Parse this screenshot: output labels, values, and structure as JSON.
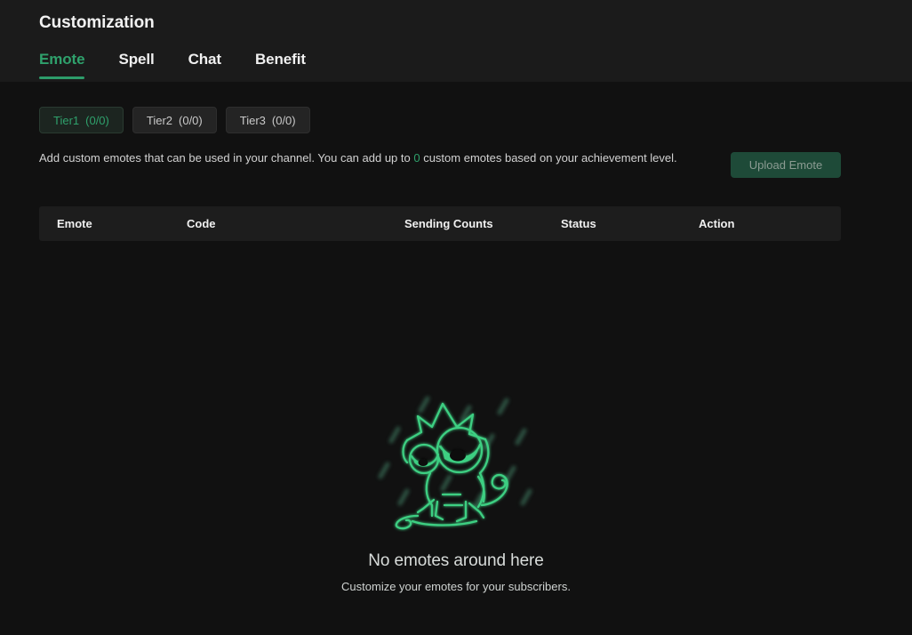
{
  "header": {
    "title": "Customization",
    "tabs": [
      {
        "label": "Emote",
        "active": true
      },
      {
        "label": "Spell",
        "active": false
      },
      {
        "label": "Chat",
        "active": false
      },
      {
        "label": "Benefit",
        "active": false
      }
    ]
  },
  "tiers": [
    {
      "label": "Tier1",
      "count": "(0/0)",
      "active": true
    },
    {
      "label": "Tier2",
      "count": "(0/0)",
      "active": false
    },
    {
      "label": "Tier3",
      "count": "(0/0)",
      "active": false
    }
  ],
  "description": {
    "part1": "Add custom emotes that can be used in your channel. You can add up to ",
    "highlight": "0",
    "part2": " custom emotes based on your achievement level."
  },
  "upload": {
    "label": "Upload Emote"
  },
  "table": {
    "columns": [
      {
        "key": "emote",
        "label": "Emote"
      },
      {
        "key": "code",
        "label": "Code"
      },
      {
        "key": "count",
        "label": "Sending Counts"
      },
      {
        "key": "status",
        "label": "Status"
      },
      {
        "key": "action",
        "label": "Action"
      }
    ],
    "rows": []
  },
  "empty_state": {
    "illustration": "chameleon-rain-illustration",
    "title": "No emotes around here",
    "subtitle": "Customize your emotes for your subscribers."
  },
  "colors": {
    "accent_green": "#2fa16c",
    "page_background": "#111111",
    "header_background": "#1b1b1b",
    "table_header_background": "#1d1d1d",
    "chip_background": "#242424",
    "chip_active_background": "#1c2520",
    "upload_button_background": "#1e4a38",
    "upload_button_text": "#8b9b92"
  }
}
